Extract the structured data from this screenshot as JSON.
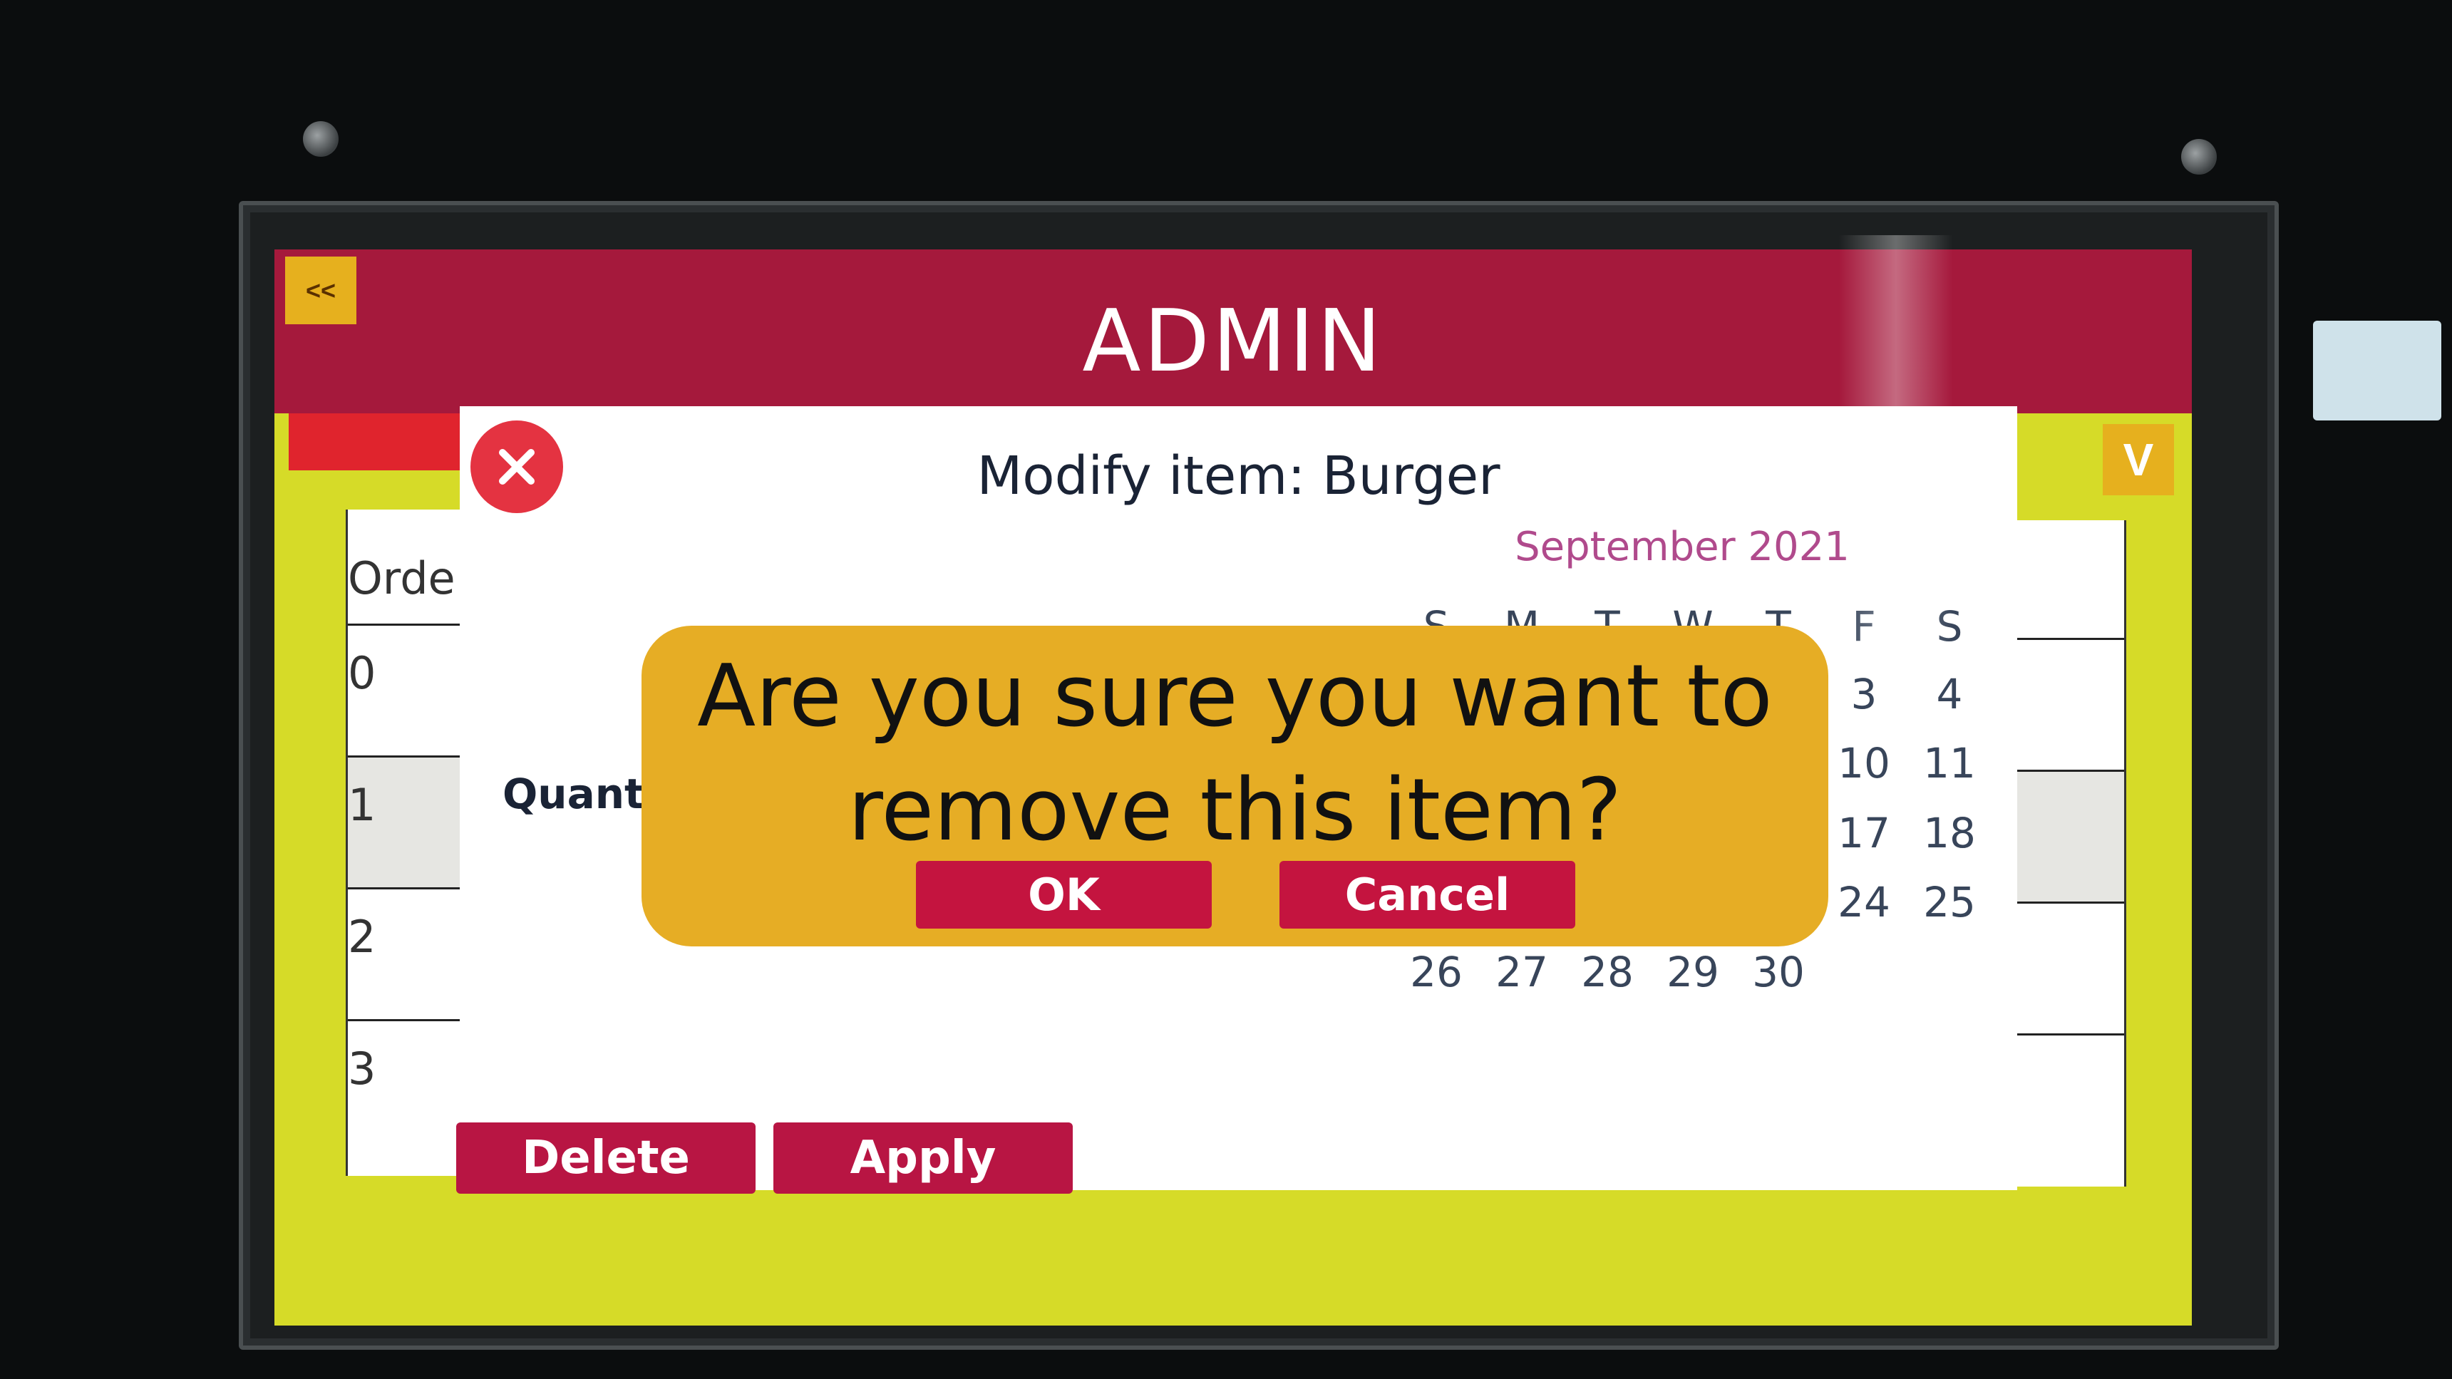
{
  "header": {
    "back_label": "<<",
    "title": "ADMIN",
    "down_label": "V"
  },
  "left_list": {
    "header": "Orde",
    "rows": [
      "0",
      "1",
      "2",
      "3"
    ]
  },
  "modal": {
    "title": "Modify item: Burger",
    "quantity_label": "Quant",
    "delete_label": "Delete",
    "apply_label": "Apply"
  },
  "calendar": {
    "month": "September 2021",
    "weekdays": [
      "S",
      "M",
      "T",
      "W",
      "T",
      "F",
      "S"
    ],
    "visible_dates": {
      "row1": [
        "3",
        "4"
      ],
      "row2": [
        "10",
        "11"
      ],
      "row3": [
        "17",
        "18"
      ],
      "row4": [
        "24",
        "25"
      ],
      "row5": [
        "26",
        "27",
        "28",
        "29",
        "30"
      ]
    }
  },
  "confirm": {
    "message_line1": "Are you sure you want to",
    "message_line2": "remove this item?",
    "ok_label": "OK",
    "cancel_label": "Cancel"
  },
  "colors": {
    "header": "#a5193c",
    "screen_bg": "#d6db28",
    "dialog": "#e6ad25",
    "button": "#b81543",
    "accent": "#e6b01e"
  }
}
